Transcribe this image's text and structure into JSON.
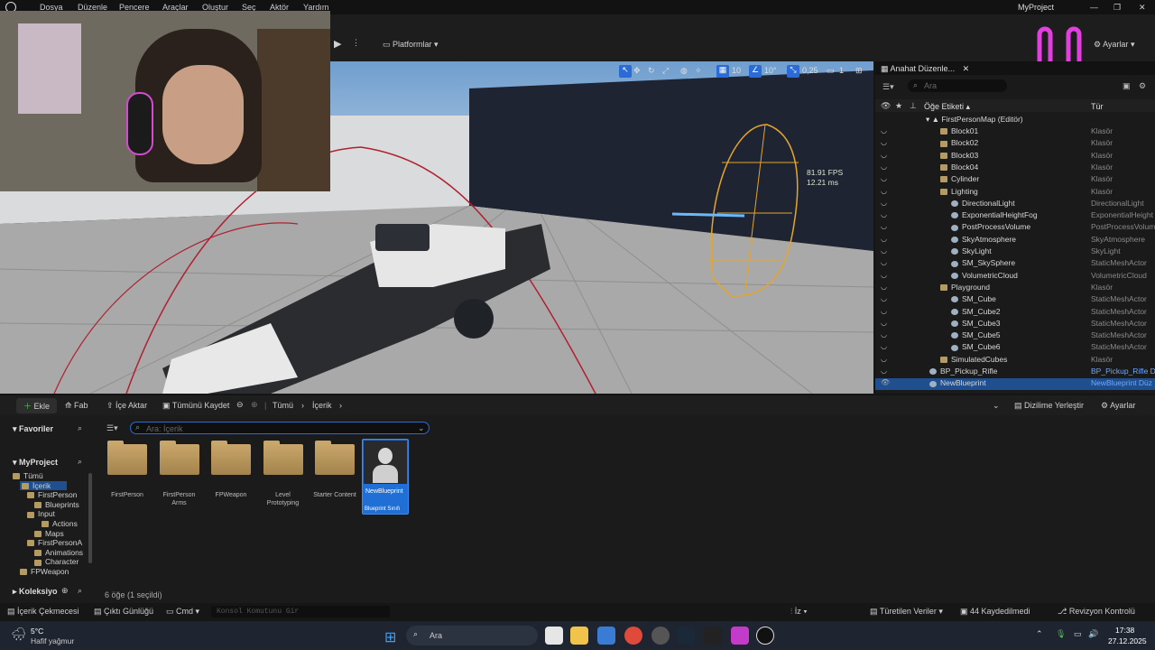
{
  "menu": [
    "Dosya",
    "Düzenle",
    "Pencere",
    "Araçlar",
    "Oluştur",
    "Seç",
    "Aktör",
    "Yardım"
  ],
  "project_name": "MyProject",
  "toolbar": {
    "platforms": "Platformlar",
    "settings": "Ayarlar"
  },
  "viewport": {
    "fps": "81.91 FPS",
    "ms": "12.21 ms",
    "grid": "10",
    "angle": "10°",
    "scale": "0,25",
    "camera": "1"
  },
  "outliner": {
    "tab": "Anahat Düzenle...",
    "search_placeholder": "Ara",
    "col_label": "Öğe Etiketi",
    "col_type": "Tür",
    "map": "FirstPersonMap (Editör)",
    "rows": [
      {
        "name": "Block01",
        "type": "Klasör",
        "icon": "folder"
      },
      {
        "name": "Block02",
        "type": "Klasör",
        "icon": "folder"
      },
      {
        "name": "Block03",
        "type": "Klasör",
        "icon": "folder"
      },
      {
        "name": "Block04",
        "type": "Klasör",
        "icon": "folder"
      },
      {
        "name": "Cylinder",
        "type": "Klasör",
        "icon": "folder"
      },
      {
        "name": "Lighting",
        "type": "Klasör",
        "icon": "folder"
      },
      {
        "name": "DirectionalLight",
        "type": "DirectionalLight",
        "icon": "actor"
      },
      {
        "name": "ExponentialHeightFog",
        "type": "ExponentialHeight",
        "icon": "actor"
      },
      {
        "name": "PostProcessVolume",
        "type": "PostProcessVolume",
        "icon": "actor"
      },
      {
        "name": "SkyAtmosphere",
        "type": "SkyAtmosphere",
        "icon": "actor"
      },
      {
        "name": "SkyLight",
        "type": "SkyLight",
        "icon": "actor"
      },
      {
        "name": "SM_SkySphere",
        "type": "StaticMeshActor",
        "icon": "actor"
      },
      {
        "name": "VolumetricCloud",
        "type": "VolumetricCloud",
        "icon": "actor"
      },
      {
        "name": "Playground",
        "type": "Klasör",
        "icon": "folder"
      },
      {
        "name": "SM_Cube",
        "type": "StaticMeshActor",
        "icon": "actor"
      },
      {
        "name": "SM_Cube2",
        "type": "StaticMeshActor",
        "icon": "actor"
      },
      {
        "name": "SM_Cube3",
        "type": "StaticMeshActor",
        "icon": "actor"
      },
      {
        "name": "SM_Cube5",
        "type": "StaticMeshActor",
        "icon": "actor"
      },
      {
        "name": "SM_Cube6",
        "type": "StaticMeshActor",
        "icon": "actor"
      },
      {
        "name": "SimulatedCubes",
        "type": "Klasör",
        "icon": "folder"
      },
      {
        "name": "BP_Pickup_Rifle",
        "type": "BP_Pickup_Rifle D",
        "icon": "actor"
      },
      {
        "name": "NewBlueprint",
        "type": "NewBlueprint Düz",
        "icon": "actor"
      }
    ]
  },
  "content": {
    "add": "Ekle",
    "fab": "Fab",
    "import": "İçe Aktar",
    "save_all": "Tümünü Kaydet",
    "crumb_all": "Tümü",
    "crumb_content": "İçerik",
    "dock": "Dizilime Yerleştir",
    "settings": "Ayarlar",
    "favorites": "Favoriler",
    "project": "MyProject",
    "search_placeholder": "Ara: İçerik",
    "tree": [
      "Tümü",
      "İçerik",
      "FirstPerson",
      "Blueprints",
      "Input",
      "Actions",
      "Maps",
      "FirstPersonA",
      "Animations",
      "Character",
      "FPWeapon"
    ],
    "collections": "Koleksiyo",
    "assets": [
      "FirstPerson",
      "FirstPerson Arms",
      "FPWeapon",
      "Level Prototyping",
      "Starter Content"
    ],
    "selected_asset": {
      "name": "NewBlueprint",
      "type": "Blueprint Sınıfı"
    },
    "count": "6 öğe (1 seçildi)"
  },
  "status": {
    "drawer": "İçerik Çekmecesi",
    "output": "Çıktı Günlüğü",
    "cmd": "Cmd",
    "console_placeholder": "Konsol Komutunu Gir",
    "derived": "Türetilen Veriler",
    "unsaved": "44 Kaydedilmedi",
    "revision": "Revizyon Kontrolü",
    "trace": "İz"
  },
  "taskbar": {
    "temp": "5°C",
    "weather": "Hafif yağmur",
    "search": "Ara",
    "time": "17:38",
    "date": "27.12.2025"
  }
}
